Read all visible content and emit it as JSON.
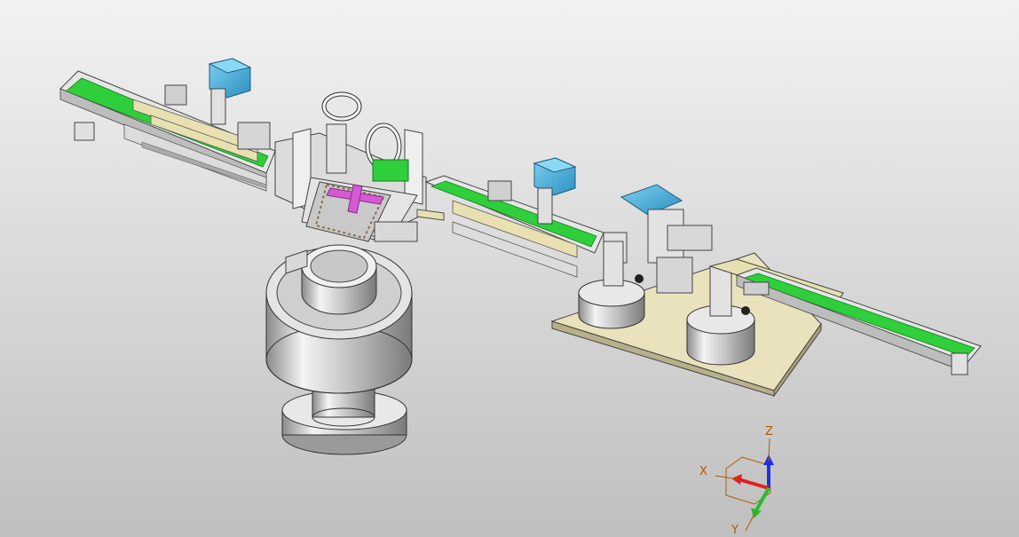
{
  "viewport": {
    "background_top": "#f2f2f2",
    "background_bottom": "#bfbfbf"
  },
  "model": {
    "components": [
      "feed-conveyor-left",
      "motor-box-left",
      "transfer-station-center",
      "vibratory-bowl-feeder",
      "motor-box-middle",
      "label-unit-right",
      "round-tanks-platform",
      "output-conveyor-right"
    ],
    "colors": {
      "belt_green": "#2ecf3a",
      "motor_blue": "#3aa7d6",
      "rail_cream": "#e8e0b0",
      "highlight_magenta": "#d45ad4",
      "metal_grey": "#cfcfcf",
      "platform_cream": "#e9e2bd"
    }
  },
  "triad": {
    "x_label": "X",
    "y_label": "Y",
    "z_label": "Z",
    "x_color": "#e02020",
    "y_color": "#22c030",
    "z_color": "#2030e0",
    "label_color": "#b05a00"
  }
}
